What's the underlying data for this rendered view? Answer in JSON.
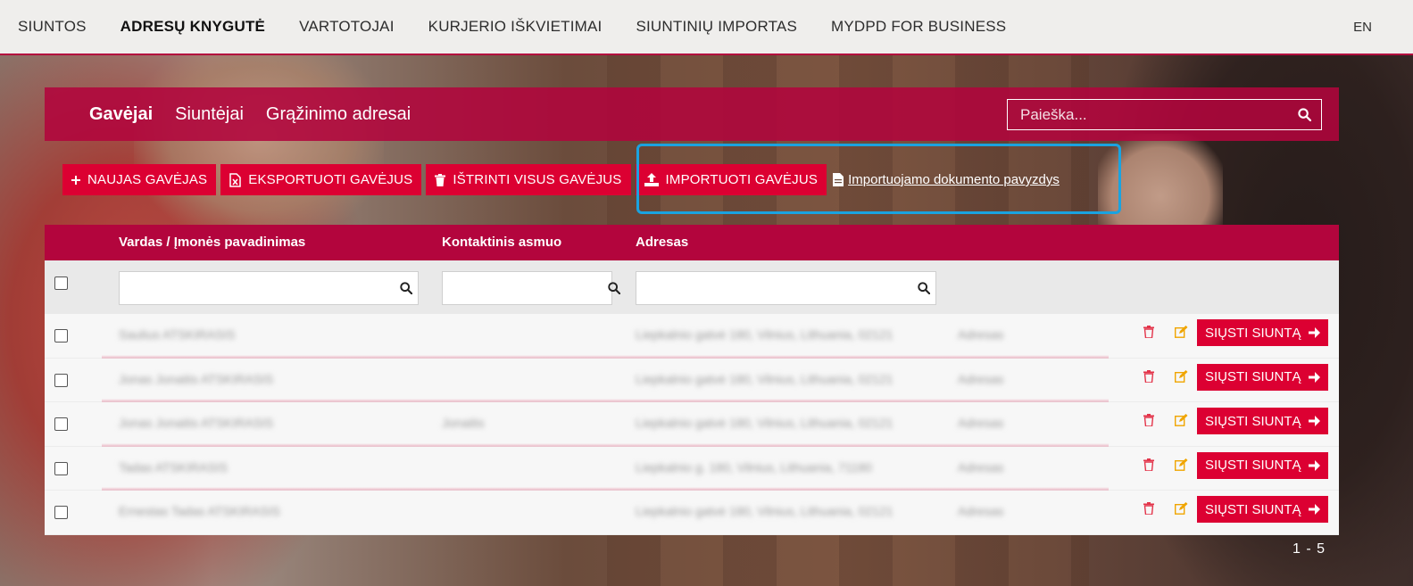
{
  "topnav": {
    "items": [
      {
        "label": "SIUNTOS",
        "active": false
      },
      {
        "label": "ADRESŲ KNYGUTĖ",
        "active": true
      },
      {
        "label": "VARTOTOJAI",
        "active": false
      },
      {
        "label": "KURJERIO IŠKVIETIMAI",
        "active": false
      },
      {
        "label": "SIUNTINIŲ IMPORTAS",
        "active": false
      },
      {
        "label": "MYDPD FOR BUSINESS",
        "active": false
      }
    ],
    "lang": "EN"
  },
  "subheader": {
    "tabs": [
      "Gavėjai",
      "Siuntėjai",
      "Grąžinimo adresai"
    ],
    "active_tab": "Gavėjai",
    "search_placeholder": "Paieška..."
  },
  "actions": {
    "new_recipient": "NAUJAS GAVĖJAS",
    "export": "EKSPORTUOTI GAVĖJUS",
    "delete_all": "IŠTRINTI VISUS GAVĖJUS",
    "import": "IMPORTUOTI GAVĖJUS",
    "sample_link": "Importuojamo dokumento pavyzdys"
  },
  "table": {
    "columns": [
      "Vardas / Įmonės pavadinimas",
      "Kontaktinis asmuo",
      "Adresas"
    ],
    "send_label": "SIŲSTI SIUNTĄ",
    "rows": [
      {
        "name": "Saulius",
        "id": "ATSKIRASIS",
        "contact": "",
        "address": "Liepkalnio gatvė 180, Vilnius, Lithuania, 02121",
        "type": "Adresas"
      },
      {
        "name": "Jonas Jonaitis",
        "id": "ATSKIRASIS",
        "contact": "",
        "address": "Liepkalnio gatvė 180, Vilnius, Lithuania, 02121",
        "type": "Adresas"
      },
      {
        "name": "Jonas Jonaitis",
        "id": "ATSKIRASIS",
        "contact": "Jonaitis",
        "address": "Liepkalnio gatvė 180, Vilnius, Lithuania, 02121",
        "type": "Adresas"
      },
      {
        "name": "Tadas",
        "id": "ATSKIRASIS",
        "contact": "",
        "address": "Liepkalnio g. 180, Vilnius, Lithuania, 71180",
        "type": "Adresas"
      },
      {
        "name": "Ernestas Tadas",
        "id": "ATSKIRASIS",
        "contact": "",
        "address": "Liepkalnio gatvė 180, Vilnius, Lithuania, 02121",
        "type": "Adresas"
      }
    ]
  },
  "pager": "1 - 5",
  "colors": {
    "brand": "#dc0032",
    "brand_dark": "#b3053d",
    "highlight": "#1aa3e0",
    "edit_icon": "#f0a500"
  }
}
